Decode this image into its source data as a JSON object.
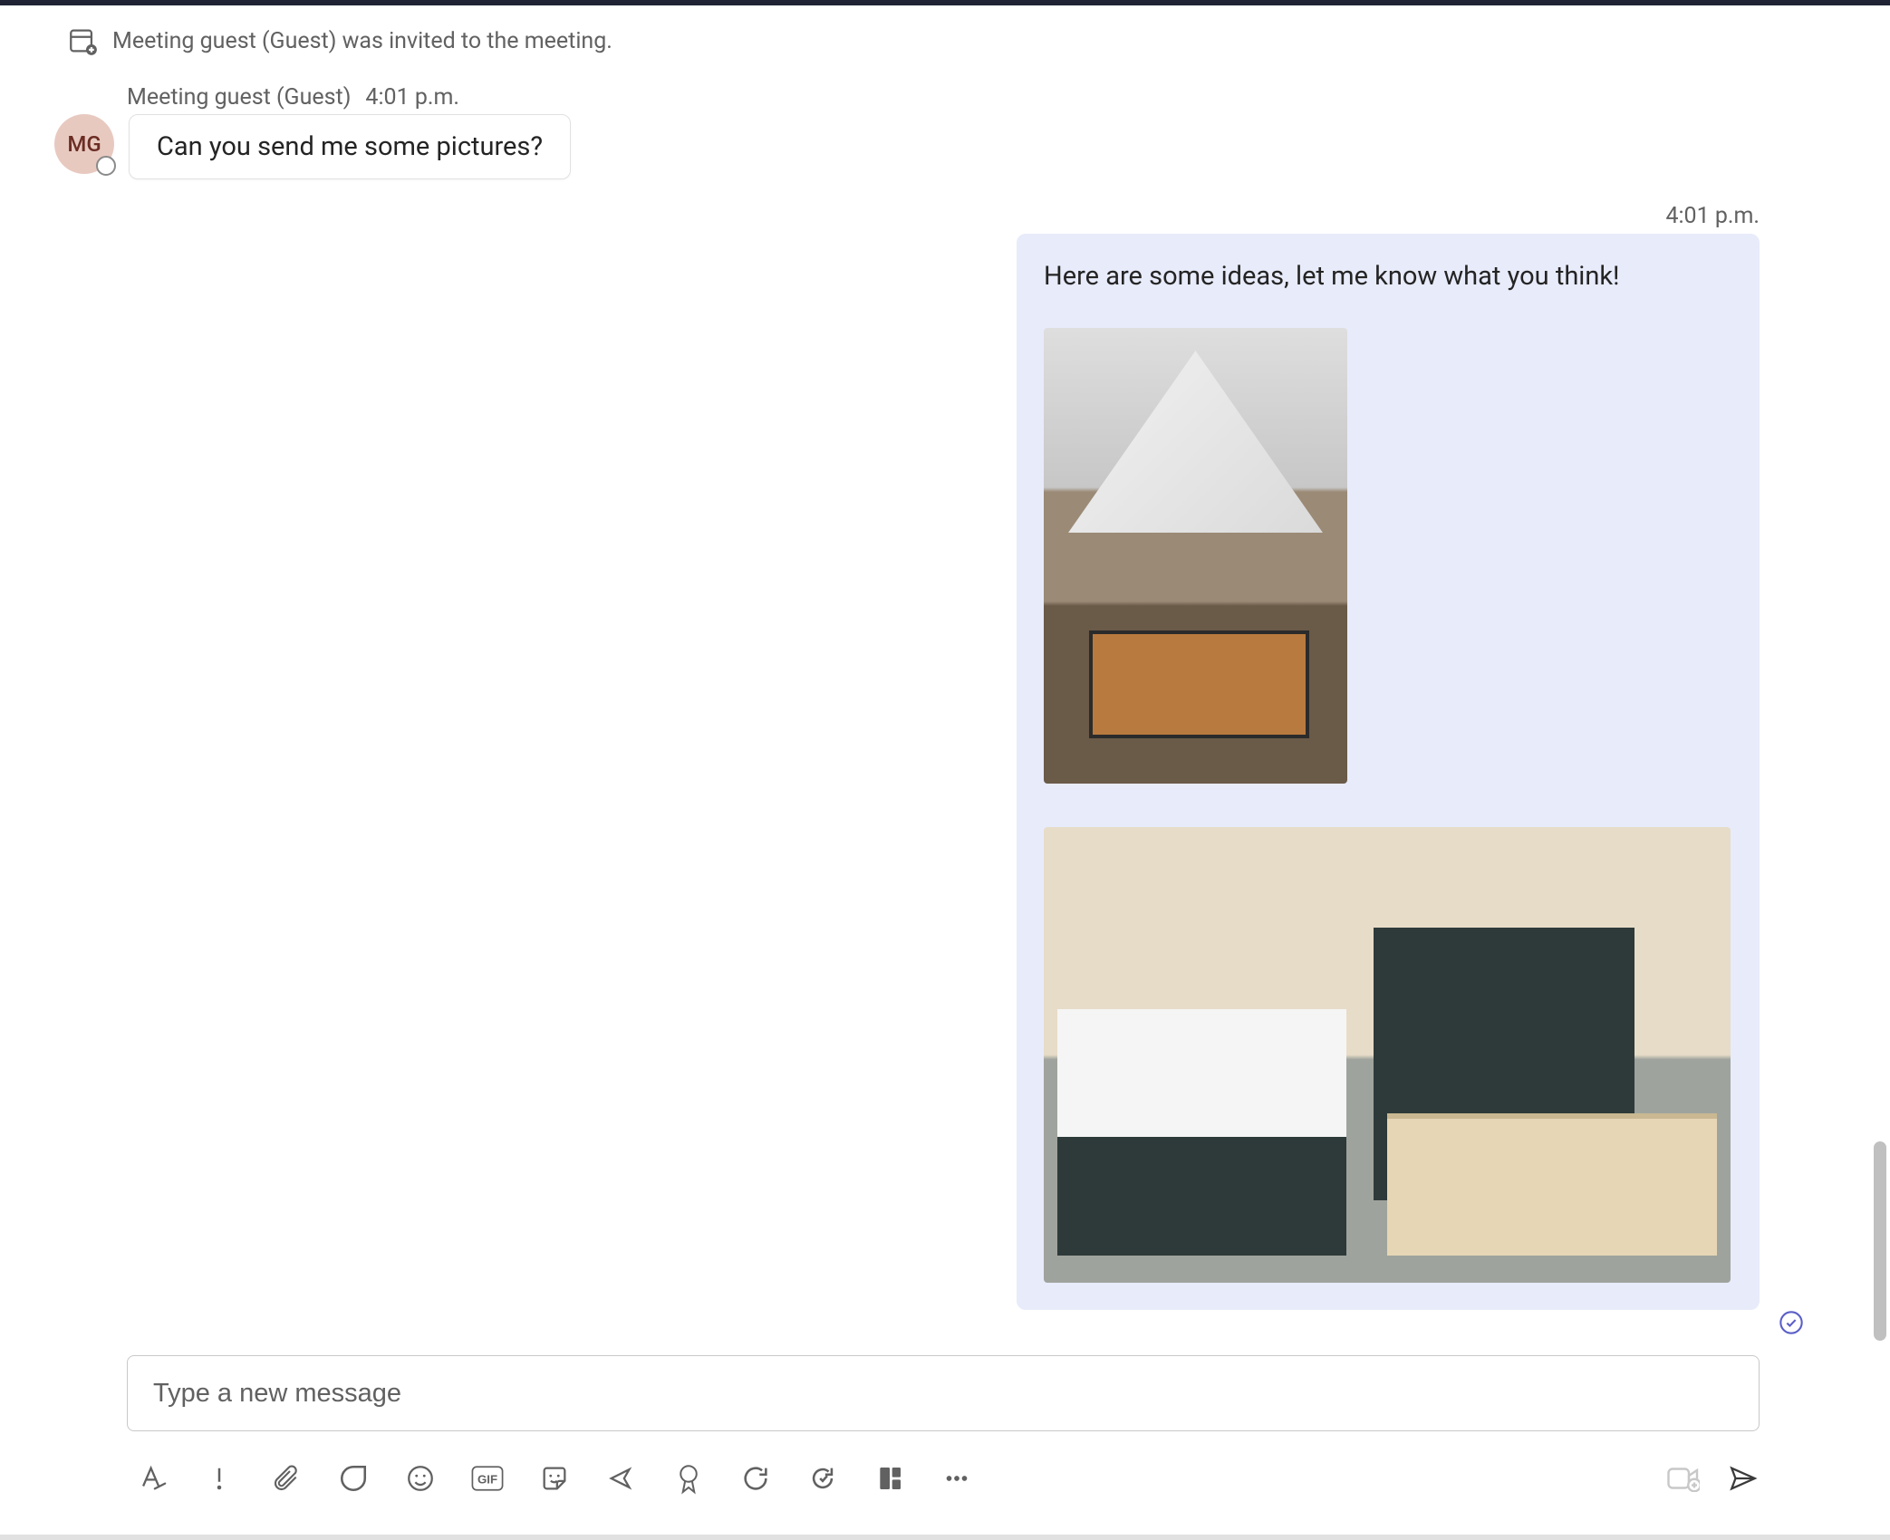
{
  "system_event": {
    "icon": "calendar-add-icon",
    "text": "Meeting guest (Guest) was invited to the meeting."
  },
  "incoming": {
    "sender": "Meeting guest (Guest)",
    "time": "4:01 p.m.",
    "avatar_initials": "MG",
    "message": "Can you send me some pictures?"
  },
  "outgoing": {
    "time": "4:01 p.m.",
    "message": "Here are some ideas, let me know what you think!",
    "attachments": [
      {
        "kind": "image",
        "alt": "living-room-interior"
      },
      {
        "kind": "image",
        "alt": "kitchen-interior"
      }
    ],
    "status_icon": "seen-check-icon"
  },
  "composer": {
    "placeholder": "Type a new message"
  },
  "toolbar": {
    "left_icons": [
      "format-icon",
      "priority-icon",
      "attach-icon",
      "loop-icon",
      "emoji-icon",
      "gif-icon",
      "sticker-icon",
      "share-icon",
      "approvals-icon",
      "refresh-icon",
      "updates-icon",
      "stream-icon",
      "more-icon"
    ],
    "right_icons": [
      "video-clip-icon",
      "send-icon"
    ]
  }
}
